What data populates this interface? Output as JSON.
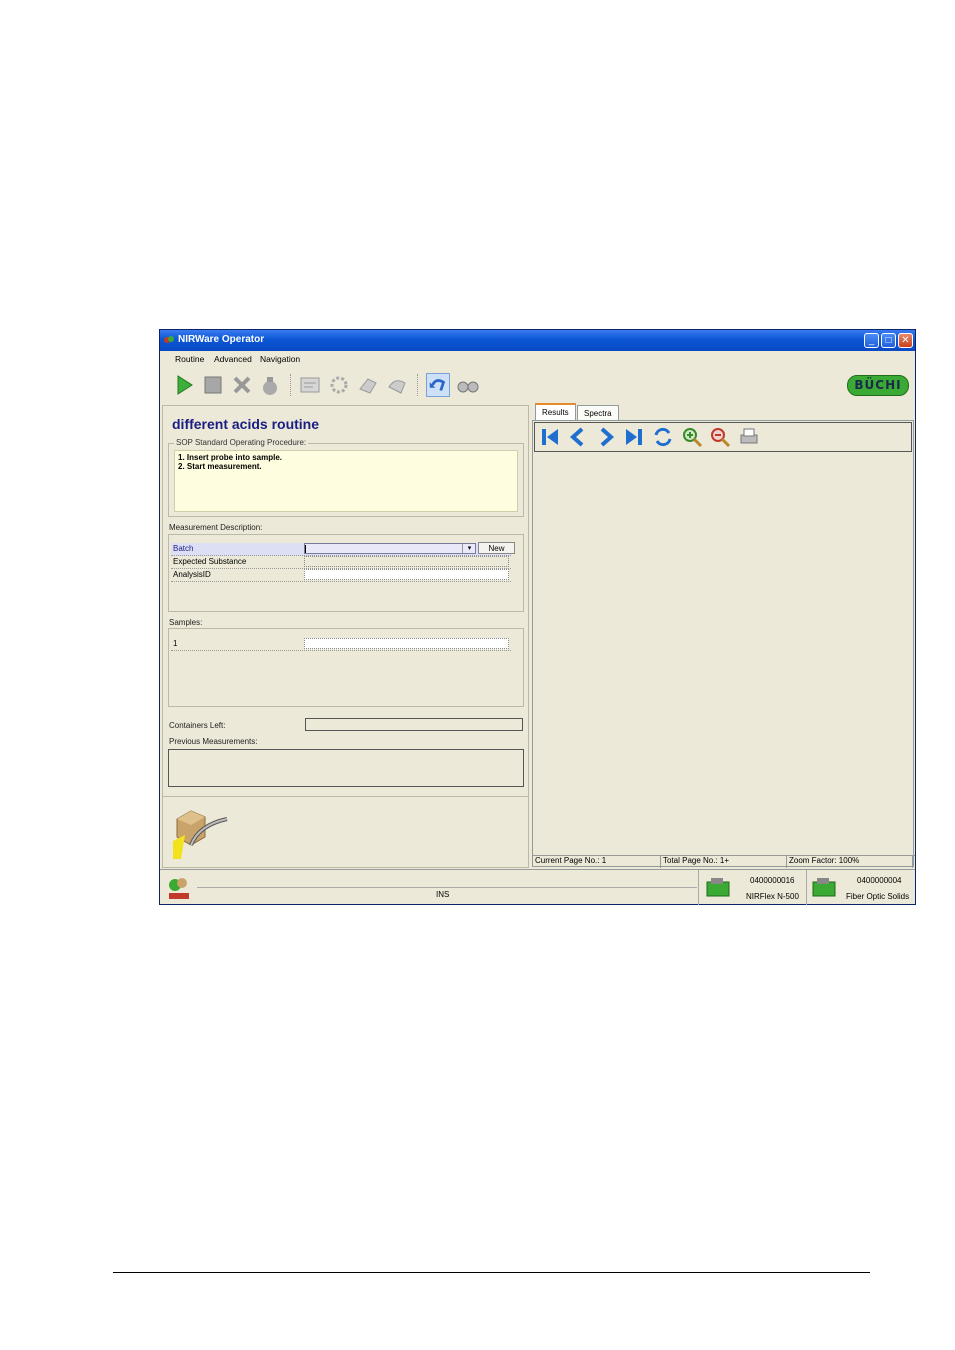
{
  "window": {
    "title": "NIRWare Operator",
    "controls": [
      "minimize",
      "maximize",
      "close"
    ]
  },
  "menu": [
    "Routine",
    "Advanced",
    "Navigation"
  ],
  "toolbar": {
    "icons": [
      "play-icon",
      "stop-icon",
      "delete-icon",
      "bag-icon",
      "card-icon",
      "gear-refresh-icon",
      "hand-icon",
      "hand-icon",
      "undo-icon",
      "binoculars-icon"
    ]
  },
  "brand": {
    "logo_text": "BÜCHI",
    "color": "#3aaa35"
  },
  "left": {
    "routine_title": "different acids routine",
    "sop_label": "SOP Standard Operating Procedure:",
    "sop_lines": [
      "1. Insert probe into sample.",
      "2. Start measurement."
    ],
    "measurement_label": "Measurement Description:",
    "fields": [
      {
        "label": "Batch",
        "value": ""
      },
      {
        "label": "Expected Substance",
        "value": ""
      },
      {
        "label": "AnalysisID",
        "value": ""
      }
    ],
    "new_button": "New",
    "samples_label": "Samples:",
    "sample_rows": [
      "1"
    ],
    "containers_left_label": "Containers Left:",
    "previous_label": "Previous Measurements:"
  },
  "right": {
    "tabs": [
      "Results",
      "Spectra"
    ],
    "active_tab": "Results",
    "nav_icons": [
      "first-page-icon",
      "prev-page-icon",
      "next-page-icon",
      "last-page-icon",
      "refresh-icon",
      "zoom-in-icon",
      "zoom-out-icon",
      "print-icon"
    ],
    "status": {
      "current_page": "Current Page No.: 1",
      "total_page": "Total Page No.: 1+",
      "zoom": "Zoom Factor: 100%"
    }
  },
  "statusbar": {
    "mode": "INS",
    "instrument_serial": "0400000016",
    "instrument_name": "NIRFlex N-500",
    "cell_serial": "0400000004",
    "cell_name": "Fiber Optic Solids"
  }
}
